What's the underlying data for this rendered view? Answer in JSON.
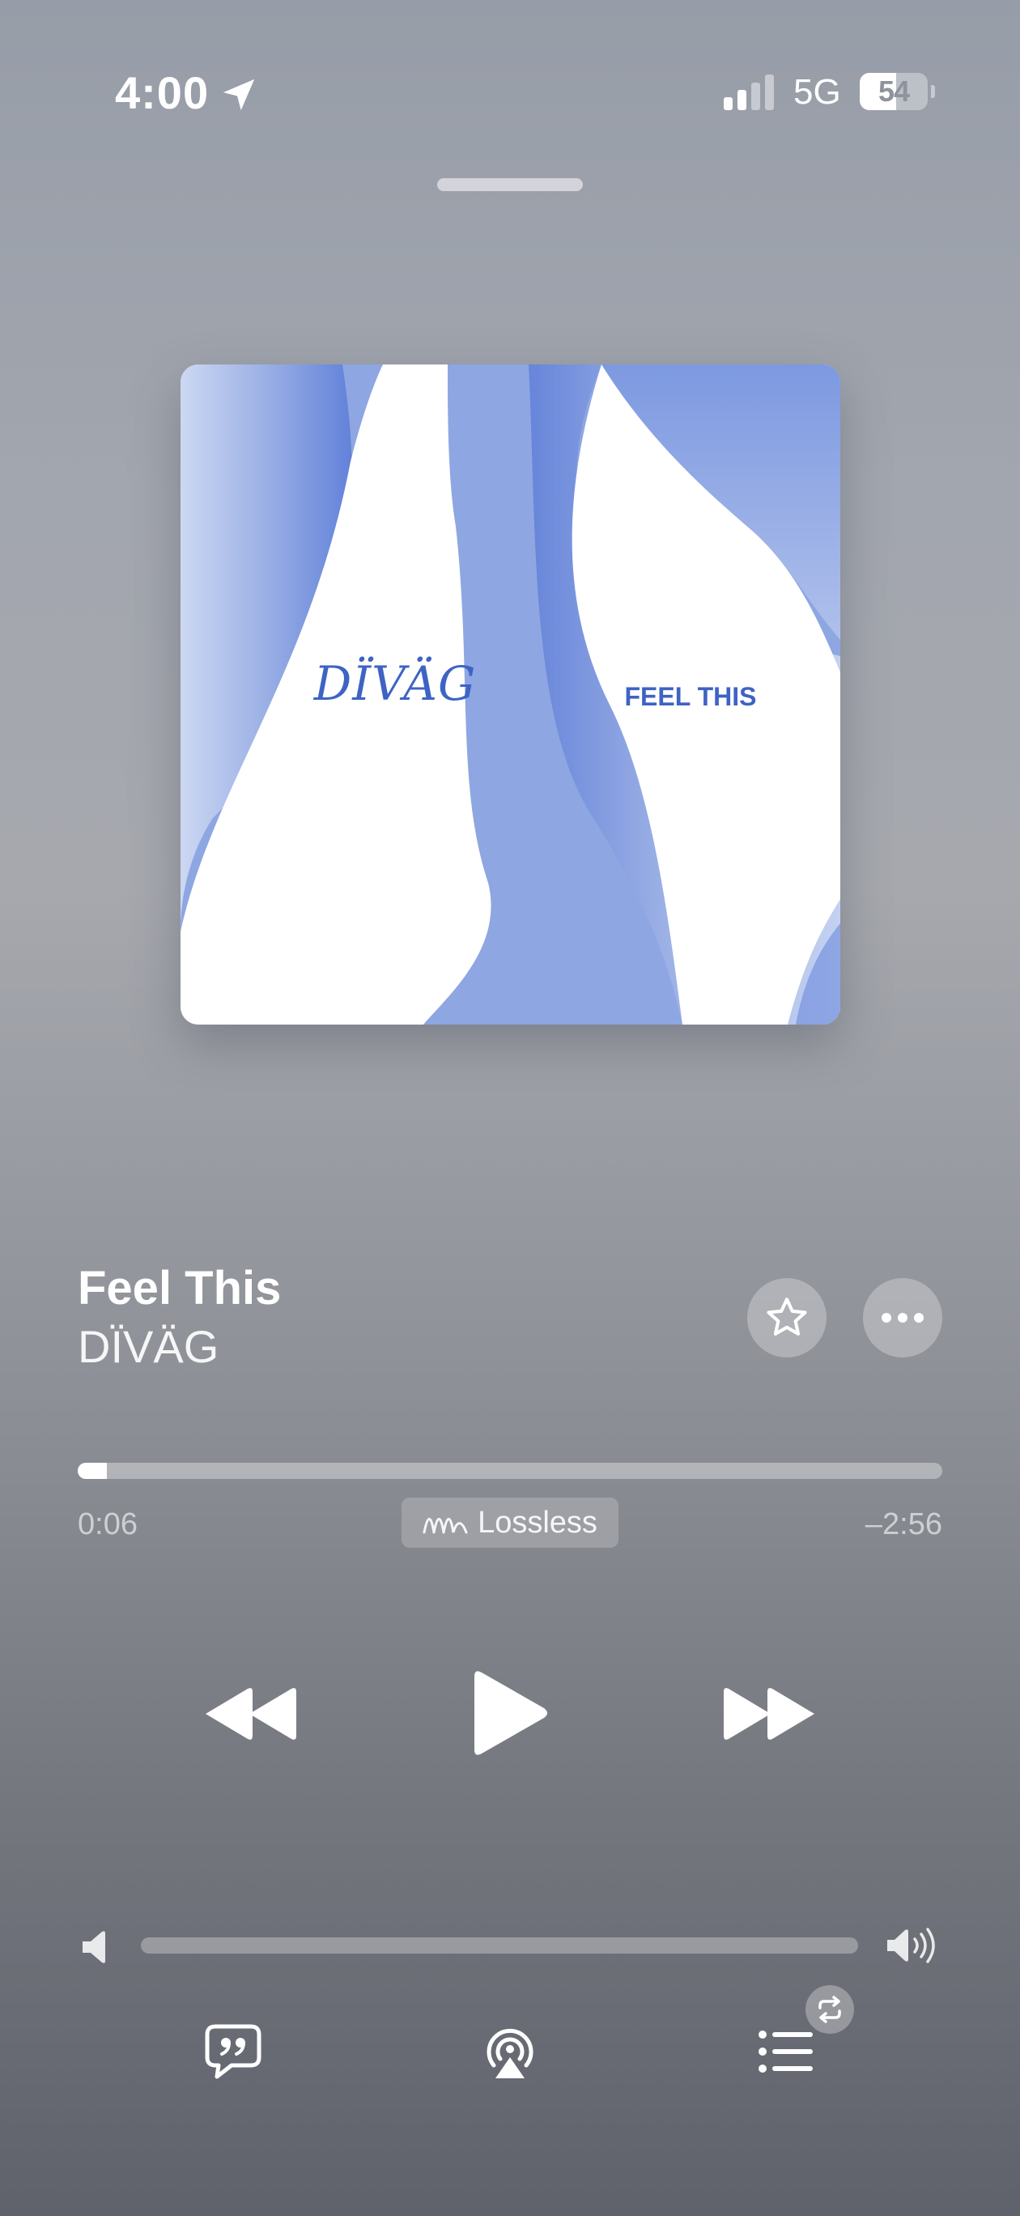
{
  "status_bar": {
    "time": "4:00",
    "network": "5G",
    "battery_level": "54",
    "battery_fraction": 0.54,
    "signal_bars_active": 2,
    "signal_bars_total": 4,
    "icons": [
      "location-arrow-icon",
      "cellular-signal-icon",
      "battery-icon"
    ]
  },
  "artwork": {
    "artist_logo_text": "DÏVÄG",
    "title_text": "FEEL THIS",
    "accent_color": "#3f63c4"
  },
  "track": {
    "title": "Feel This",
    "artist": "DÏVÄG",
    "favorite_icon": "star-outline-icon",
    "more_icon": "ellipsis-icon"
  },
  "playback": {
    "elapsed": "0:06",
    "remaining": "–2:56",
    "progress_fraction": 0.034,
    "quality_badge": "Lossless",
    "quality_icon": "lossless-wave-icon",
    "state": "paused"
  },
  "controls": {
    "rewind_icon": "rewind-icon",
    "play_icon": "play-icon",
    "forward_icon": "fast-forward-icon"
  },
  "volume": {
    "level_fraction": 0.0,
    "low_icon": "speaker-low-icon",
    "high_icon": "speaker-high-icon"
  },
  "bottom_bar": {
    "lyrics_icon": "lyrics-quote-icon",
    "airplay_icon": "airplay-audio-icon",
    "queue_icon": "queue-list-icon",
    "repeat_icon": "repeat-icon"
  }
}
